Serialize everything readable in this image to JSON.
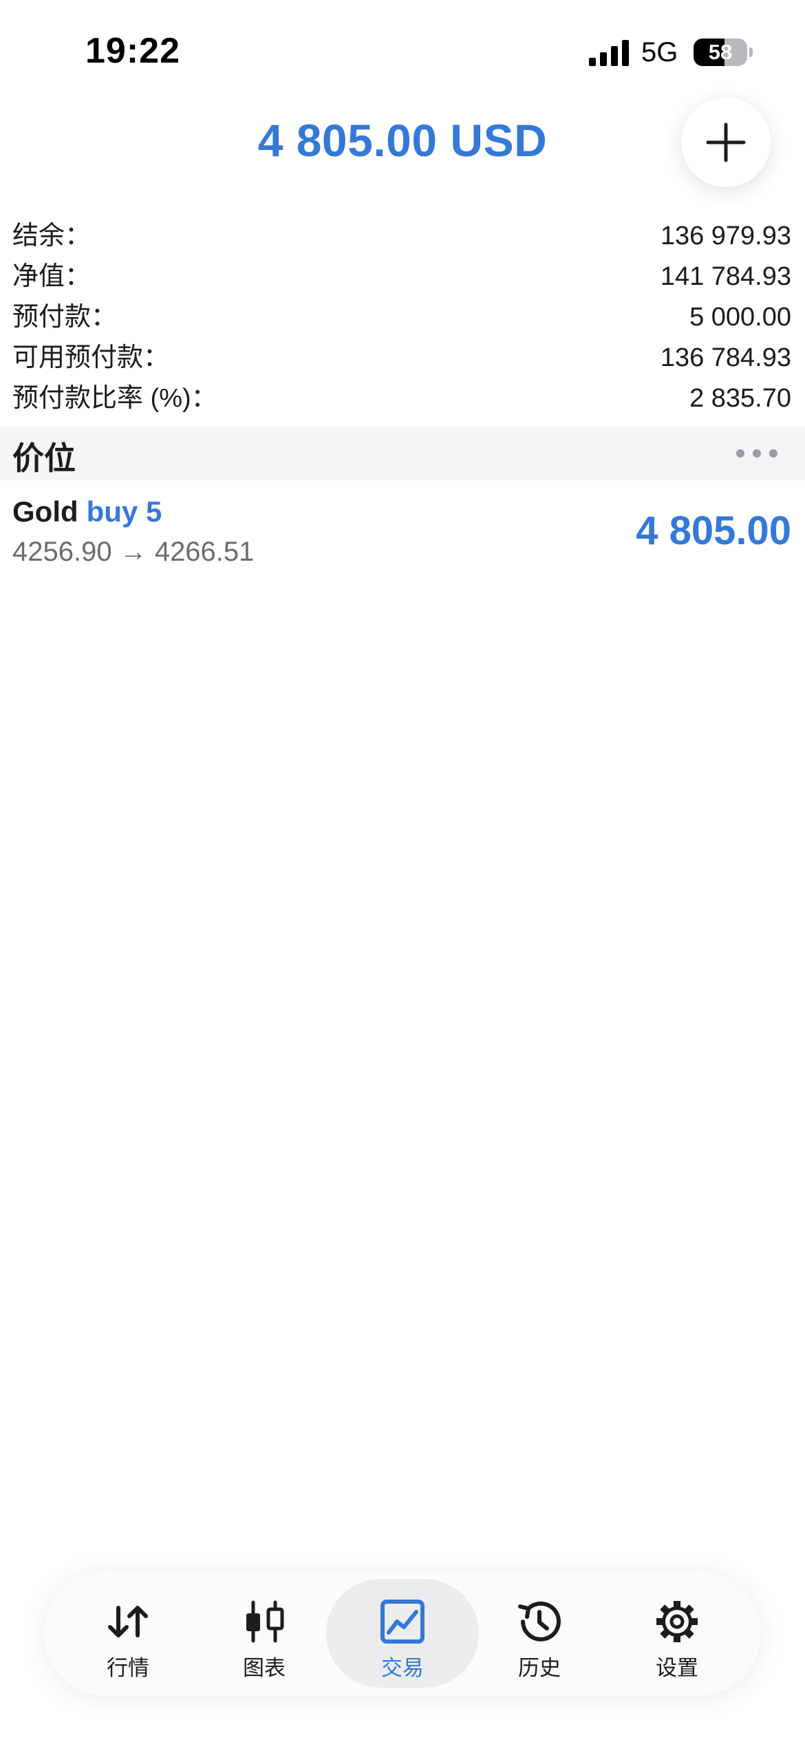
{
  "status_bar": {
    "time": "19:22",
    "network": "5G",
    "battery_level": "58"
  },
  "header": {
    "total": "4 805.00 USD"
  },
  "summary": {
    "rows": [
      {
        "label": "结余：",
        "value": "136 979.93"
      },
      {
        "label": "净值：",
        "value": "141 784.93"
      },
      {
        "label": "预付款：",
        "value": "5 000.00"
      },
      {
        "label": "可用预付款：",
        "value": "136 784.93"
      },
      {
        "label": "预付款比率 (%)：",
        "value": "2 835.70"
      }
    ]
  },
  "positions": {
    "title": "价位",
    "items": [
      {
        "symbol": "Gold",
        "side": "buy 5",
        "prices": "4256.90 → 4266.51",
        "profit": "4 805.00"
      }
    ]
  },
  "tabs": [
    {
      "label": "行情",
      "icon": "quotes-arrows-icon"
    },
    {
      "label": "图表",
      "icon": "candlestick-chart-icon"
    },
    {
      "label": "交易",
      "icon": "trade-chart-icon",
      "active": true
    },
    {
      "label": "历史",
      "icon": "history-clock-icon"
    },
    {
      "label": "设置",
      "icon": "gear-icon"
    }
  ],
  "colors": {
    "accent": "#3478d8",
    "text": "#1c1c1e",
    "secondary_text": "#6b6b70",
    "section_bg": "#f5f5f7"
  }
}
